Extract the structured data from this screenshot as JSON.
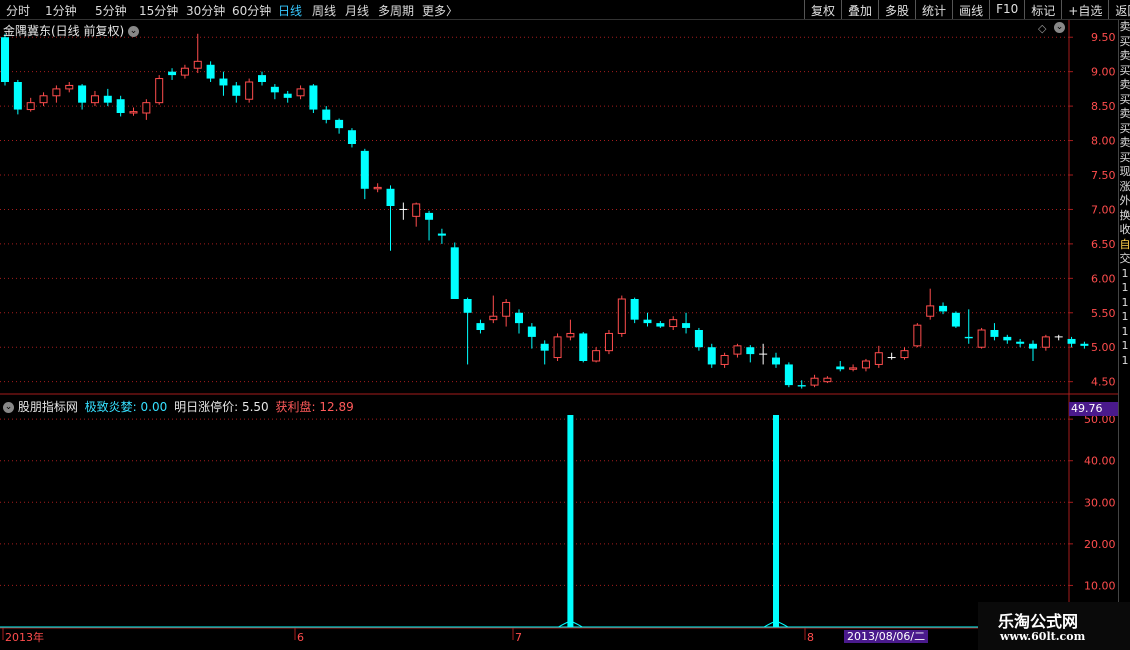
{
  "toolbar": {
    "periods": [
      "分时",
      "1分钟",
      "5分钟",
      "15分钟",
      "30分钟",
      "60分钟",
      "日线",
      "周线",
      "月线",
      "多周期",
      "更多"
    ],
    "active_period": "日线",
    "more_arrow": "〉",
    "buttons": [
      "复权",
      "叠加",
      "多股",
      "统计",
      "画线",
      "F10",
      "标记",
      "+自选",
      "返回"
    ]
  },
  "main_panel": {
    "title": "金隅冀东(日线 前复权)",
    "price_axis": [
      "9.50",
      "9.00",
      "8.50",
      "8.00",
      "7.50",
      "7.00",
      "6.50",
      "6.00",
      "5.50",
      "5.00",
      "4.50"
    ]
  },
  "indicator_panel": {
    "name": "股朋指标网",
    "label1": "极致炎婪:",
    "value1": "0.00",
    "label2": "明日涨停价:",
    "value2": "5.50",
    "label3": "获利盘:",
    "value3": "12.89",
    "current_value": "49.76",
    "axis": [
      "50.00",
      "40.00",
      "30.00",
      "20.00",
      "10.00"
    ]
  },
  "date_axis": {
    "labels": [
      "2013年",
      "6",
      "7",
      "8"
    ],
    "cursor_date": "2013/08/06/二"
  },
  "watermark": {
    "title": "乐淘公式网",
    "url": "www.60lt.com"
  },
  "sidebar_chars": [
    "卖",
    "买",
    "卖",
    "买",
    "卖",
    "买",
    "卖",
    "买",
    "卖",
    "买",
    "现",
    "涨",
    "外",
    "换",
    "收",
    "自",
    "交",
    "1",
    "1",
    "1",
    "1",
    "1",
    "1",
    "1"
  ],
  "colors": {
    "up": "#ff4d4d",
    "down": "#00ffff",
    "axis": "#a51d1d",
    "active": "#36c8ff"
  },
  "chart_data": {
    "type": "candlestick",
    "title": "金隅冀东(日线 前复权)",
    "y_range": [
      4.35,
      9.75
    ],
    "candles": [
      {
        "o": 9.5,
        "c": 8.85,
        "h": 9.55,
        "l": 8.8
      },
      {
        "o": 8.85,
        "c": 8.45,
        "h": 8.88,
        "l": 8.38
      },
      {
        "o": 8.45,
        "c": 8.55,
        "h": 8.62,
        "l": 8.42
      },
      {
        "o": 8.55,
        "c": 8.65,
        "h": 8.7,
        "l": 8.5
      },
      {
        "o": 8.65,
        "c": 8.75,
        "h": 8.8,
        "l": 8.55
      },
      {
        "o": 8.75,
        "c": 8.8,
        "h": 8.85,
        "l": 8.7
      },
      {
        "o": 8.8,
        "c": 8.55,
        "h": 8.82,
        "l": 8.45
      },
      {
        "o": 8.55,
        "c": 8.65,
        "h": 8.72,
        "l": 8.5
      },
      {
        "o": 8.65,
        "c": 8.55,
        "h": 8.75,
        "l": 8.5
      },
      {
        "o": 8.6,
        "c": 8.4,
        "h": 8.65,
        "l": 8.35
      },
      {
        "o": 8.4,
        "c": 8.42,
        "h": 8.48,
        "l": 8.36
      },
      {
        "o": 8.4,
        "c": 8.55,
        "h": 8.6,
        "l": 8.3
      },
      {
        "o": 8.55,
        "c": 8.9,
        "h": 8.95,
        "l": 8.52
      },
      {
        "o": 9.0,
        "c": 8.95,
        "h": 9.05,
        "l": 8.88
      },
      {
        "o": 8.95,
        "c": 9.05,
        "h": 9.1,
        "l": 8.9
      },
      {
        "o": 9.05,
        "c": 9.15,
        "h": 9.55,
        "l": 8.98
      },
      {
        "o": 9.1,
        "c": 8.9,
        "h": 9.15,
        "l": 8.85
      },
      {
        "o": 8.9,
        "c": 8.8,
        "h": 9.0,
        "l": 8.65
      },
      {
        "o": 8.8,
        "c": 8.65,
        "h": 8.85,
        "l": 8.55
      },
      {
        "o": 8.6,
        "c": 8.85,
        "h": 8.9,
        "l": 8.55
      },
      {
        "o": 8.95,
        "c": 8.85,
        "h": 9.0,
        "l": 8.8
      },
      {
        "o": 8.78,
        "c": 8.7,
        "h": 8.82,
        "l": 8.6
      },
      {
        "o": 8.68,
        "c": 8.62,
        "h": 8.72,
        "l": 8.55
      },
      {
        "o": 8.65,
        "c": 8.75,
        "h": 8.8,
        "l": 8.6
      },
      {
        "o": 8.8,
        "c": 8.45,
        "h": 8.82,
        "l": 8.4
      },
      {
        "o": 8.45,
        "c": 8.3,
        "h": 8.5,
        "l": 8.25
      },
      {
        "o": 8.3,
        "c": 8.18,
        "h": 8.32,
        "l": 8.1
      },
      {
        "o": 8.15,
        "c": 7.95,
        "h": 8.18,
        "l": 7.9
      },
      {
        "o": 7.85,
        "c": 7.3,
        "h": 7.88,
        "l": 7.15
      },
      {
        "o": 7.3,
        "c": 7.32,
        "h": 7.38,
        "l": 7.25
      },
      {
        "o": 7.3,
        "c": 7.05,
        "h": 7.35,
        "l": 6.4
      },
      {
        "o": 7.0,
        "c": 7.0,
        "h": 7.1,
        "l": 6.85
      },
      {
        "o": 6.9,
        "c": 7.08,
        "h": 7.1,
        "l": 6.75
      },
      {
        "o": 6.95,
        "c": 6.85,
        "h": 6.98,
        "l": 6.55
      },
      {
        "o": 6.65,
        "c": 6.62,
        "h": 6.72,
        "l": 6.5
      },
      {
        "o": 6.45,
        "c": 5.7,
        "h": 6.52,
        "l": 5.7
      },
      {
        "o": 5.7,
        "c": 5.5,
        "h": 5.72,
        "l": 4.75
      },
      {
        "o": 5.35,
        "c": 5.25,
        "h": 5.4,
        "l": 5.2
      },
      {
        "o": 5.4,
        "c": 5.45,
        "h": 5.75,
        "l": 5.35
      },
      {
        "o": 5.45,
        "c": 5.65,
        "h": 5.7,
        "l": 5.3
      },
      {
        "o": 5.5,
        "c": 5.35,
        "h": 5.55,
        "l": 5.2
      },
      {
        "o": 5.3,
        "c": 5.15,
        "h": 5.35,
        "l": 4.98
      },
      {
        "o": 5.05,
        "c": 4.95,
        "h": 5.1,
        "l": 4.75
      },
      {
        "o": 4.85,
        "c": 5.15,
        "h": 5.2,
        "l": 4.8
      },
      {
        "o": 5.15,
        "c": 5.2,
        "h": 5.4,
        "l": 5.1
      },
      {
        "o": 5.2,
        "c": 4.8,
        "h": 5.22,
        "l": 4.78
      },
      {
        "o": 4.8,
        "c": 4.95,
        "h": 5.0,
        "l": 4.78
      },
      {
        "o": 4.95,
        "c": 5.2,
        "h": 5.25,
        "l": 4.9
      },
      {
        "o": 5.2,
        "c": 5.7,
        "h": 5.75,
        "l": 5.15
      },
      {
        "o": 5.7,
        "c": 5.4,
        "h": 5.72,
        "l": 5.35
      },
      {
        "o": 5.4,
        "c": 5.35,
        "h": 5.5,
        "l": 5.3
      },
      {
        "o": 5.35,
        "c": 5.3,
        "h": 5.38,
        "l": 5.28
      },
      {
        "o": 5.3,
        "c": 5.4,
        "h": 5.45,
        "l": 5.25
      },
      {
        "o": 5.35,
        "c": 5.28,
        "h": 5.5,
        "l": 5.2
      },
      {
        "o": 5.25,
        "c": 5.0,
        "h": 5.28,
        "l": 4.95
      },
      {
        "o": 5.0,
        "c": 4.75,
        "h": 5.05,
        "l": 4.7
      },
      {
        "o": 4.75,
        "c": 4.88,
        "h": 4.92,
        "l": 4.7
      },
      {
        "o": 4.9,
        "c": 5.02,
        "h": 5.05,
        "l": 4.85
      },
      {
        "o": 5.0,
        "c": 4.9,
        "h": 5.03,
        "l": 4.78
      },
      {
        "o": 4.9,
        "c": 4.9,
        "h": 5.05,
        "l": 4.75
      },
      {
        "o": 4.85,
        "c": 4.75,
        "h": 4.92,
        "l": 4.7
      },
      {
        "o": 4.75,
        "c": 4.45,
        "h": 4.78,
        "l": 4.42
      },
      {
        "o": 4.45,
        "c": 4.43,
        "h": 4.52,
        "l": 4.4
      },
      {
        "o": 4.45,
        "c": 4.55,
        "h": 4.6,
        "l": 4.42
      },
      {
        "o": 4.5,
        "c": 4.55,
        "h": 4.58,
        "l": 4.48
      },
      {
        "o": 4.72,
        "c": 4.68,
        "h": 4.8,
        "l": 4.65
      },
      {
        "o": 4.68,
        "c": 4.7,
        "h": 4.75,
        "l": 4.65
      },
      {
        "o": 4.7,
        "c": 4.8,
        "h": 4.83,
        "l": 4.65
      },
      {
        "o": 4.75,
        "c": 4.92,
        "h": 5.02,
        "l": 4.7
      },
      {
        "o": 4.85,
        "c": 4.85,
        "h": 4.92,
        "l": 4.82
      },
      {
        "o": 4.85,
        "c": 4.95,
        "h": 5.0,
        "l": 4.82
      },
      {
        "o": 5.02,
        "c": 5.32,
        "h": 5.35,
        "l": 5.0
      },
      {
        "o": 5.45,
        "c": 5.6,
        "h": 5.85,
        "l": 5.4
      },
      {
        "o": 5.6,
        "c": 5.52,
        "h": 5.65,
        "l": 5.48
      },
      {
        "o": 5.5,
        "c": 5.3,
        "h": 5.52,
        "l": 5.28
      },
      {
        "o": 5.15,
        "c": 5.13,
        "h": 5.55,
        "l": 5.05
      },
      {
        "o": 5.0,
        "c": 5.25,
        "h": 5.28,
        "l": 4.98
      },
      {
        "o": 5.25,
        "c": 5.15,
        "h": 5.35,
        "l": 5.1
      },
      {
        "o": 5.15,
        "c": 5.1,
        "h": 5.18,
        "l": 5.05
      },
      {
        "o": 5.08,
        "c": 5.05,
        "h": 5.12,
        "l": 5.0
      },
      {
        "o": 5.05,
        "c": 4.98,
        "h": 5.1,
        "l": 4.8
      },
      {
        "o": 5.0,
        "c": 5.15,
        "h": 5.18,
        "l": 4.95
      },
      {
        "o": 5.15,
        "c": 5.15,
        "h": 5.18,
        "l": 5.1
      },
      {
        "o": 5.12,
        "c": 5.05,
        "h": 5.15,
        "l": 5.0
      },
      {
        "o": 5.05,
        "c": 5.02,
        "h": 5.08,
        "l": 4.98
      }
    ],
    "indicator": {
      "y_range": [
        0,
        51
      ],
      "spikes": [
        {
          "index": 44,
          "value": 51
        },
        {
          "index": 60,
          "value": 51
        }
      ]
    }
  }
}
